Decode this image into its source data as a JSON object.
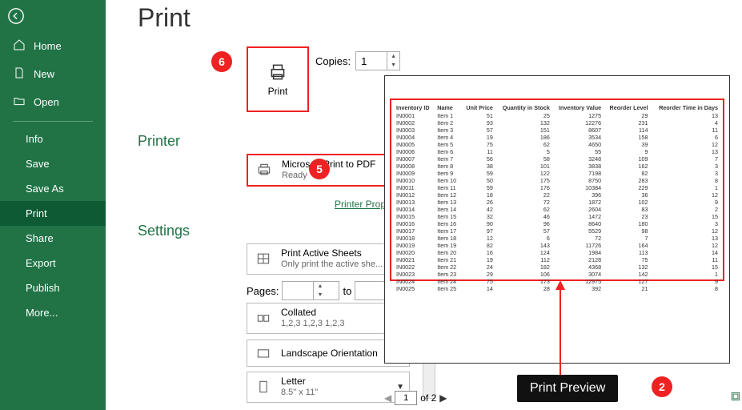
{
  "sidebar": {
    "items": [
      "Home",
      "New",
      "Open",
      "Info",
      "Save",
      "Save As",
      "Print",
      "Share",
      "Export",
      "Publish",
      "More..."
    ]
  },
  "page": {
    "title": "Print"
  },
  "printBtn": {
    "label": "Print"
  },
  "copies": {
    "label": "Copies:",
    "value": "1"
  },
  "printer": {
    "heading": "Printer",
    "name": "Microsoft Print to PDF",
    "status": "Ready",
    "propsLink": "Printer Properties"
  },
  "settings": {
    "heading": "Settings",
    "scope": {
      "title": "Print Active Sheets",
      "sub": "Only print the active she..."
    },
    "pagesLabel": "Pages:",
    "toLabel": "to",
    "collate": {
      "title": "Collated",
      "sub": "1,2,3   1,2,3   1,2,3"
    },
    "orient": {
      "title": "Landscape Orientation"
    },
    "paper": {
      "title": "Letter",
      "sub": "8.5\" x 11\""
    }
  },
  "preview": {
    "headers": [
      "Inventory ID",
      "Name",
      "Unit Price",
      "Quantity in Stock",
      "Inventory Value",
      "Reorder Level",
      "Reorder Time in Days"
    ],
    "rows": [
      [
        "IN0001",
        "Item 1",
        "51",
        "25",
        "1275",
        "29",
        "13"
      ],
      [
        "IN0002",
        "Item 2",
        "93",
        "132",
        "12276",
        "231",
        "4"
      ],
      [
        "IN0003",
        "Item 3",
        "57",
        "151",
        "8607",
        "114",
        "11"
      ],
      [
        "IN0004",
        "Item 4",
        "19",
        "186",
        "3534",
        "158",
        "6"
      ],
      [
        "IN0005",
        "Item 5",
        "75",
        "62",
        "4650",
        "39",
        "12"
      ],
      [
        "IN0006",
        "Item 6",
        "11",
        "5",
        "55",
        "9",
        "13"
      ],
      [
        "IN0007",
        "Item 7",
        "56",
        "58",
        "3248",
        "109",
        "7"
      ],
      [
        "IN0008",
        "Item 8",
        "38",
        "101",
        "3838",
        "162",
        "3"
      ],
      [
        "IN0009",
        "Item 9",
        "59",
        "122",
        "7198",
        "82",
        "3"
      ],
      [
        "IN0010",
        "Item 10",
        "50",
        "175",
        "8750",
        "283",
        "8"
      ],
      [
        "IN0011",
        "Item 11",
        "59",
        "176",
        "10384",
        "229",
        "1"
      ],
      [
        "IN0012",
        "Item 12",
        "18",
        "22",
        "396",
        "36",
        "12"
      ],
      [
        "IN0013",
        "Item 13",
        "26",
        "72",
        "1872",
        "102",
        "9"
      ],
      [
        "IN0014",
        "Item 14",
        "42",
        "62",
        "2604",
        "83",
        "2"
      ],
      [
        "IN0015",
        "Item 15",
        "32",
        "46",
        "1472",
        "23",
        "15"
      ],
      [
        "IN0016",
        "Item 16",
        "90",
        "96",
        "8640",
        "180",
        "3"
      ],
      [
        "IN0017",
        "Item 17",
        "97",
        "57",
        "5529",
        "98",
        "12"
      ],
      [
        "IN0018",
        "Item 18",
        "12",
        "6",
        "72",
        "7",
        "13"
      ],
      [
        "IN0019",
        "Item 19",
        "82",
        "143",
        "11726",
        "164",
        "12"
      ],
      [
        "IN0020",
        "Item 20",
        "16",
        "124",
        "1984",
        "113",
        "14"
      ],
      [
        "IN0021",
        "Item 21",
        "19",
        "112",
        "2128",
        "75",
        "11"
      ],
      [
        "IN0022",
        "Item 22",
        "24",
        "182",
        "4368",
        "132",
        "15"
      ],
      [
        "IN0023",
        "Item 23",
        "29",
        "106",
        "3074",
        "142",
        "1"
      ],
      [
        "IN0024",
        "Item 24",
        "75",
        "173",
        "12975",
        "127",
        "9"
      ],
      [
        "IN0025",
        "Item 25",
        "14",
        "28",
        "392",
        "21",
        "8"
      ]
    ],
    "callout": "Print Preview",
    "page": "1",
    "of": "of 2"
  },
  "badges": {
    "five": "5",
    "six": "6",
    "two": "2"
  }
}
